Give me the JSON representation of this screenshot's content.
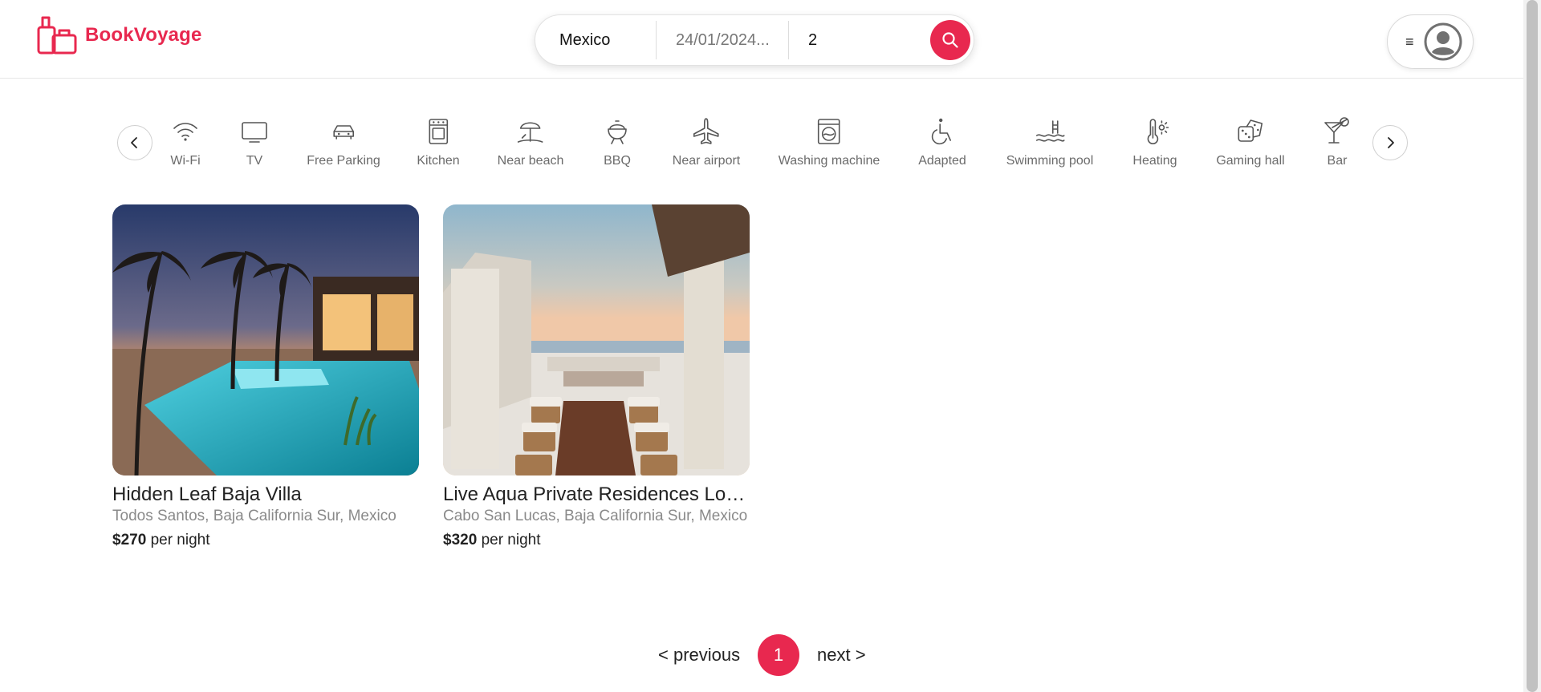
{
  "brand": {
    "name": "BookVoyage",
    "color": "#e8284f"
  },
  "search": {
    "destination": "Mexico",
    "date": "24/01/2024...",
    "guests": "2"
  },
  "user_menu": {
    "menu_icon": "≡"
  },
  "filters": {
    "prev_icon": "chevron-left-icon",
    "next_icon": "chevron-right-icon",
    "items": [
      {
        "label": "Wi-Fi",
        "icon": "wifi-icon"
      },
      {
        "label": "TV",
        "icon": "tv-icon"
      },
      {
        "label": "Free Parking",
        "icon": "car-icon"
      },
      {
        "label": "Kitchen",
        "icon": "oven-icon"
      },
      {
        "label": "Near beach",
        "icon": "beach-umbrella-icon"
      },
      {
        "label": "BBQ",
        "icon": "grill-icon"
      },
      {
        "label": "Near airport",
        "icon": "airplane-icon"
      },
      {
        "label": "Washing machine",
        "icon": "washing-machine-icon"
      },
      {
        "label": "Adapted",
        "icon": "wheelchair-icon"
      },
      {
        "label": "Swimming pool",
        "icon": "pool-icon"
      },
      {
        "label": "Heating",
        "icon": "thermometer-icon"
      },
      {
        "label": "Gaming hall",
        "icon": "dice-icon"
      },
      {
        "label": "Bar",
        "icon": "cocktail-icon"
      }
    ]
  },
  "listings": [
    {
      "title": "Hidden Leaf Baja Villa",
      "location": "Todos Santos, Baja California Sur, Mexico",
      "price": "$270",
      "price_suffix": "per night"
    },
    {
      "title": "Live Aqua Private Residences Los...",
      "location": "Cabo San Lucas, Baja California Sur, Mexico",
      "price": "$320",
      "price_suffix": "per night"
    }
  ],
  "pagination": {
    "previous": "< previous",
    "current": "1",
    "next": "next >"
  }
}
